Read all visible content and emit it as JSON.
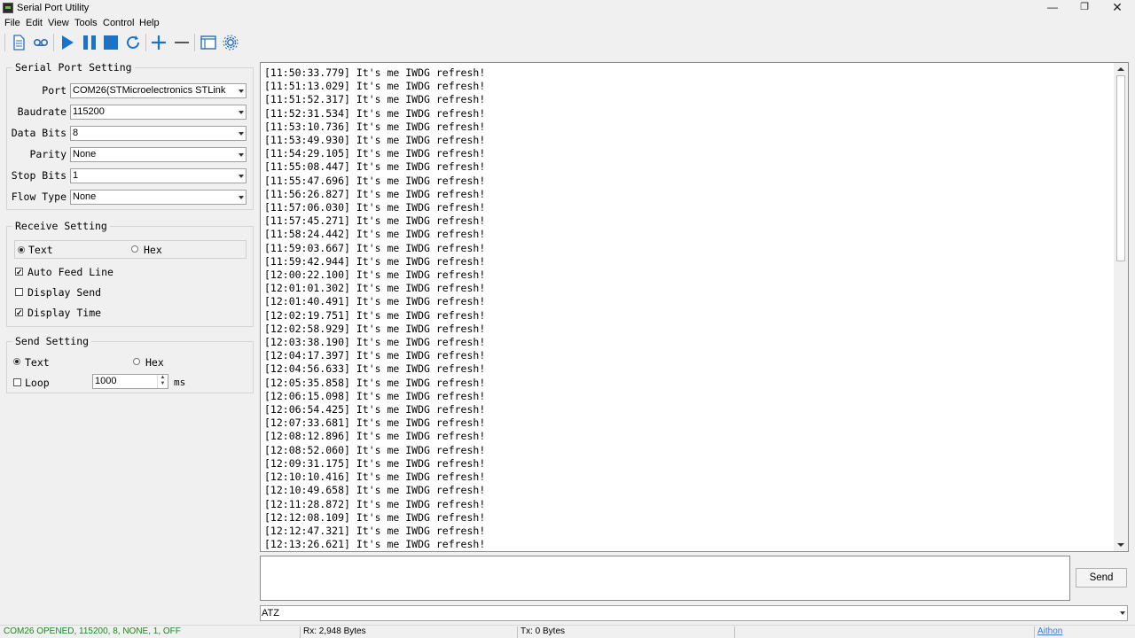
{
  "window": {
    "title": "Serial Port Utility",
    "minimize": "—",
    "maximize": "❐",
    "close": "✕"
  },
  "menu": [
    "File",
    "Edit",
    "View",
    "Tools",
    "Control",
    "Help"
  ],
  "toolbar": {
    "icons": [
      "new-document-icon",
      "loop-icon",
      "play-icon",
      "pause-icon",
      "stop-icon",
      "refresh-icon",
      "add-icon",
      "remove-icon",
      "window-icon",
      "settings-icon"
    ],
    "accent": "#1a73c8"
  },
  "serial_port_setting": {
    "title": "Serial Port Setting",
    "port": {
      "label": "Port",
      "value": "COM26(STMicroelectronics STLink"
    },
    "baudrate": {
      "label": "Baudrate",
      "value": "115200"
    },
    "data_bits": {
      "label": "Data Bits",
      "value": "8"
    },
    "parity": {
      "label": "Parity",
      "value": "None"
    },
    "stop_bits": {
      "label": "Stop Bits",
      "value": "1"
    },
    "flow_type": {
      "label": "Flow Type",
      "value": "None"
    }
  },
  "receive_setting": {
    "title": "Receive Setting",
    "text_label": "Text",
    "hex_label": "Hex",
    "mode": "Text",
    "auto_feed_line": {
      "label": "Auto Feed Line",
      "checked": true
    },
    "display_send": {
      "label": "Display Send",
      "checked": false
    },
    "display_time": {
      "label": "Display Time",
      "checked": true
    }
  },
  "send_setting": {
    "title": "Send Setting",
    "text_label": "Text",
    "hex_label": "Hex",
    "mode": "Text",
    "loop": {
      "label": "Loop",
      "checked": false
    },
    "interval": "1000",
    "unit": "ms"
  },
  "receive_log": [
    "[11:50:33.779] It's me IWDG refresh!",
    "[11:51:13.029] It's me IWDG refresh!",
    "[11:51:52.317] It's me IWDG refresh!",
    "[11:52:31.534] It's me IWDG refresh!",
    "[11:53:10.736] It's me IWDG refresh!",
    "[11:53:49.930] It's me IWDG refresh!",
    "[11:54:29.105] It's me IWDG refresh!",
    "[11:55:08.447] It's me IWDG refresh!",
    "[11:55:47.696] It's me IWDG refresh!",
    "[11:56:26.827] It's me IWDG refresh!",
    "[11:57:06.030] It's me IWDG refresh!",
    "[11:57:45.271] It's me IWDG refresh!",
    "[11:58:24.442] It's me IWDG refresh!",
    "[11:59:03.667] It's me IWDG refresh!",
    "[11:59:42.944] It's me IWDG refresh!",
    "[12:00:22.100] It's me IWDG refresh!",
    "[12:01:01.302] It's me IWDG refresh!",
    "[12:01:40.491] It's me IWDG refresh!",
    "[12:02:19.751] It's me IWDG refresh!",
    "[12:02:58.929] It's me IWDG refresh!",
    "[12:03:38.190] It's me IWDG refresh!",
    "[12:04:17.397] It's me IWDG refresh!",
    "[12:04:56.633] It's me IWDG refresh!",
    "[12:05:35.858] It's me IWDG refresh!",
    "[12:06:15.098] It's me IWDG refresh!",
    "[12:06:54.425] It's me IWDG refresh!",
    "[12:07:33.681] It's me IWDG refresh!",
    "[12:08:12.896] It's me IWDG refresh!",
    "[12:08:52.060] It's me IWDG refresh!",
    "[12:09:31.175] It's me IWDG refresh!",
    "[12:10:10.416] It's me IWDG refresh!",
    "[12:10:49.658] It's me IWDG refresh!",
    "[12:11:28.872] It's me IWDG refresh!",
    "[12:12:08.109] It's me IWDG refresh!",
    "[12:12:47.321] It's me IWDG refresh!",
    "[12:13:26.621] It's me IWDG refresh!"
  ],
  "send_area": {
    "text": "",
    "button_label": "Send",
    "history_value": "ATZ"
  },
  "status_bar": {
    "connection": "COM26 OPENED, 115200, 8, NONE, 1, OFF",
    "connection_color": "#1a8a1a",
    "rx": "Rx: 2,948 Bytes",
    "tx": "Tx: 0 Bytes",
    "brand": "Aithon",
    "brand_color": "#3b7bd8"
  }
}
